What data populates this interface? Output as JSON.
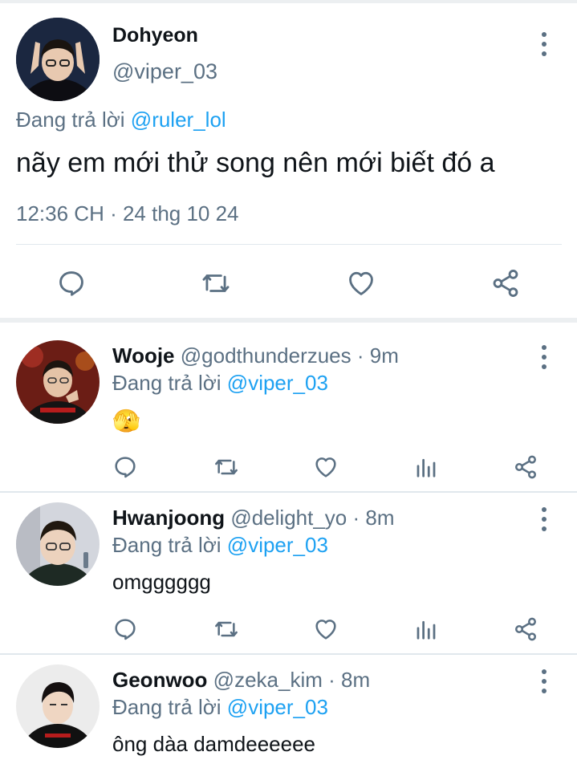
{
  "main_tweet": {
    "author_name": "Dohyeon",
    "author_handle": "@viper_03",
    "replying_prefix": "Đang trả lời",
    "replying_to": "@ruler_lol",
    "text": "nãy em mới thử song nên mới biết đó a",
    "timestamp": "12:36 CH · 24 thg 10 24",
    "actions": [
      "reply-icon",
      "retweet-icon",
      "like-icon",
      "share-icon"
    ]
  },
  "replies": [
    {
      "name": "Wooje",
      "handle": "@godthunderzues",
      "time": " · 9m",
      "replying_prefix": "Đang trả lời",
      "replying_to": "@viper_03",
      "body": "🫣",
      "avatar_bg": "#5a1a14"
    },
    {
      "name": "Hwanjoong",
      "handle": "@delight_yo",
      "time": " · 8m",
      "replying_prefix": "Đang trả lời",
      "replying_to": "@viper_03",
      "body": "omgggggg",
      "avatar_bg": "#c9ccd4"
    },
    {
      "name": "Geonwoo",
      "handle": "@zeka_kim",
      "time": " · 8m",
      "replying_prefix": "Đang trả lời",
      "replying_to": "@viper_03",
      "body": "ông dàa damdeeeeee",
      "avatar_bg": "#e8e8e8"
    }
  ],
  "reply_actions": [
    "reply-icon",
    "retweet-icon",
    "like-icon",
    "analytics-icon",
    "share-icon"
  ],
  "colors": {
    "text": "#0f1419",
    "secondary": "#5b7083",
    "link": "#1da1f2",
    "divider": "#e1e8ed"
  }
}
